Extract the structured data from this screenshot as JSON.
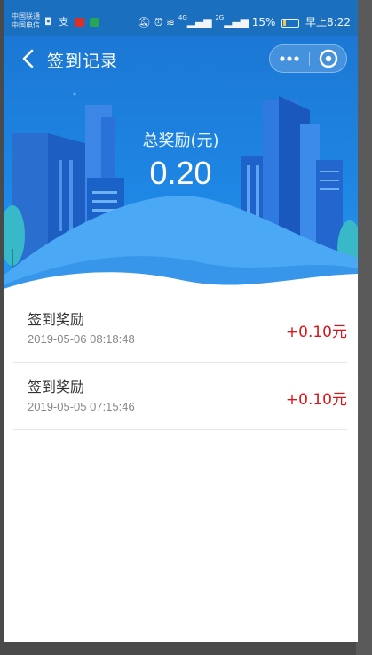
{
  "status_bar": {
    "carrier_1": "中国联通",
    "carrier_2": "中国电信",
    "network_1": "4G",
    "network_2": "2G",
    "battery_percent": "15%",
    "time": "早上8:22"
  },
  "nav": {
    "title": "签到记录",
    "back_icon": "chevron-left-icon",
    "more_icon": "more-dots-icon",
    "close_icon": "close-target-icon"
  },
  "summary": {
    "label": "总奖励(元)",
    "value": "0.20"
  },
  "records": [
    {
      "title": "签到奖励",
      "time": "2019-05-06 08:18:48",
      "amount": "+0.10元"
    },
    {
      "title": "签到奖励",
      "time": "2019-05-05 07:15:46",
      "amount": "+0.10元"
    }
  ],
  "colors": {
    "primary": "#1e86e4",
    "amount": "#d7171b"
  }
}
